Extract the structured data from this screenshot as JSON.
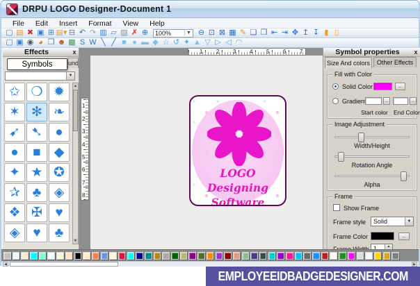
{
  "window": {
    "title": "DRPU LOGO Designer-Document 1"
  },
  "menu": {
    "items": [
      "File",
      "Edit",
      "Insert",
      "Format",
      "View",
      "Help"
    ]
  },
  "toolbar1": {
    "zoom_value": "100%",
    "icons_left": [
      {
        "name": "new-document",
        "glyph": "▢",
        "color": "#3b7fd6"
      },
      {
        "name": "open-folder",
        "glyph": "▤",
        "color": "#e09b3a"
      },
      {
        "name": "close-document",
        "glyph": "✖",
        "color": "#d02f2f"
      },
      {
        "name": "save",
        "glyph": "▣",
        "color": "#3b7fd6"
      },
      {
        "name": "save-all",
        "glyph": "⊞",
        "color": "#3b7fd6"
      },
      {
        "name": "open-recent",
        "glyph": "▤▾",
        "color": "#e09b3a"
      },
      {
        "name": "print",
        "glyph": "⊟",
        "color": "#6a7b8c"
      },
      {
        "name": "undo",
        "glyph": "↶",
        "color": "#2f6fd0"
      },
      {
        "name": "redo",
        "glyph": "↷",
        "color": "#9aa4b0"
      },
      {
        "name": "import-image",
        "glyph": "▥",
        "color": "#3b7fd6"
      },
      {
        "name": "copy",
        "glyph": "▱",
        "color": "#3b7fd6"
      },
      {
        "name": "paste",
        "glyph": "▨",
        "color": "#8a93a0"
      },
      {
        "name": "delete",
        "glyph": "✗",
        "color": "#d02f2f"
      },
      {
        "name": "zoom-in",
        "glyph": "⊕",
        "color": "#2f6fd0"
      }
    ],
    "icons_right": [
      {
        "name": "zoom-out",
        "glyph": "⊖",
        "color": "#2f6fd0"
      },
      {
        "name": "actual-size",
        "glyph": "⊡",
        "color": "#2f6fd0"
      },
      {
        "name": "fit-to-window",
        "glyph": "⊠",
        "color": "#2f6fd0"
      },
      {
        "name": "grid",
        "glyph": "▦",
        "color": "#2f6fd0"
      },
      {
        "name": "page-setup",
        "glyph": "✎",
        "color": "#caa23a"
      },
      {
        "name": "bring-to-front",
        "glyph": "❏",
        "color": "#4a5fc0"
      },
      {
        "name": "send-to-back",
        "glyph": "❐",
        "color": "#4a5fc0"
      },
      {
        "name": "align-left",
        "glyph": "⇤",
        "color": "#2f6fd0"
      },
      {
        "name": "align-right",
        "glyph": "⇥",
        "color": "#2f6fd0"
      },
      {
        "name": "align-center",
        "glyph": "✥",
        "color": "#2f6fd0"
      },
      {
        "name": "align-top",
        "glyph": "↥",
        "color": "#2f6fd0"
      },
      {
        "name": "align-bottom",
        "glyph": "↧",
        "color": "#2f6fd0"
      },
      {
        "name": "lock",
        "glyph": "▮",
        "color": "#e8a020"
      },
      {
        "name": "unlock",
        "glyph": "▯",
        "color": "#e8a020"
      }
    ]
  },
  "toolbar2": {
    "icons": [
      {
        "name": "insert-document",
        "glyph": "▢",
        "color": "#3b7fd6"
      },
      {
        "name": "insert-image",
        "glyph": "▣",
        "color": "#3b7fd6"
      },
      {
        "name": "camera",
        "glyph": "◉",
        "color": "#555a60"
      },
      {
        "name": "color-wheel",
        "glyph": "◕",
        "color": "#d0762f"
      },
      {
        "name": "library",
        "glyph": "❒",
        "color": "#3b7fd6"
      },
      {
        "name": "users",
        "glyph": "☻",
        "color": "#b0622f"
      },
      {
        "name": "picture-frame",
        "glyph": "▩",
        "color": "#3f9f5f"
      },
      {
        "name": "skew-text",
        "glyph": "S",
        "color": "#2f6fd0"
      },
      {
        "name": "word-art",
        "glyph": "W",
        "color": "#2f6fd0"
      },
      {
        "name": "line-tool",
        "glyph": "╲",
        "color": "#2f6fd0"
      },
      {
        "name": "pencil-line",
        "glyph": "╱",
        "color": "#2f6fd0"
      },
      {
        "name": "rectangle",
        "glyph": "■",
        "color": "#7fc0e8"
      },
      {
        "name": "ellipse",
        "glyph": "●",
        "color": "#7fc0e8"
      },
      {
        "name": "rounded-rectangle",
        "glyph": "▬",
        "color": "#7fc0e8"
      },
      {
        "name": "diamond",
        "glyph": "◆",
        "color": "#7fc0e8"
      },
      {
        "name": "star",
        "glyph": "☆",
        "color": "#5fa8dc"
      },
      {
        "name": "spiral",
        "glyph": "↺",
        "color": "#5fa8dc"
      },
      {
        "name": "burst",
        "glyph": "✦",
        "color": "#5fa8dc"
      },
      {
        "name": "triangle-up",
        "glyph": "▲",
        "color": "#7fc0e8"
      },
      {
        "name": "triangle-down",
        "glyph": "▽",
        "color": "#5fa8dc"
      },
      {
        "name": "triangle-right",
        "glyph": "▷",
        "color": "#5fa8dc"
      },
      {
        "name": "triangle-left",
        "glyph": "◁",
        "color": "#5fa8dc"
      },
      {
        "name": "arc",
        "glyph": "◠",
        "color": "#5fa8dc"
      }
    ]
  },
  "effects_panel": {
    "title": "Effects",
    "close": "x",
    "tooltip": "Symbols",
    "backgrounds_tab_visible": "unds",
    "selected_index": 4,
    "symbols": [
      {
        "name": "star-outline",
        "glyph": "✩"
      },
      {
        "name": "dashed-circle",
        "glyph": "❍"
      },
      {
        "name": "spiky-ball",
        "glyph": "✹"
      },
      {
        "name": "six-point-star",
        "glyph": "✶"
      },
      {
        "name": "flower",
        "glyph": "✻"
      },
      {
        "name": "leaf-swoosh",
        "glyph": "❧"
      },
      {
        "name": "curved-arrow",
        "glyph": "➹"
      },
      {
        "name": "swoosh-arrow",
        "glyph": "➷"
      },
      {
        "name": "egg",
        "glyph": "●"
      },
      {
        "name": "ellipse",
        "glyph": "●"
      },
      {
        "name": "square",
        "glyph": "■"
      },
      {
        "name": "diamond",
        "glyph": "◆"
      },
      {
        "name": "sparkle",
        "glyph": "✦"
      },
      {
        "name": "five-point-star",
        "glyph": "★"
      },
      {
        "name": "circle-star",
        "glyph": "✪"
      },
      {
        "name": "square-star",
        "glyph": "✰"
      },
      {
        "name": "club",
        "glyph": "♣"
      },
      {
        "name": "diamond-outline-star",
        "glyph": "◈"
      },
      {
        "name": "diamond-sparkle",
        "glyph": "❖"
      },
      {
        "name": "diamond-cross",
        "glyph": "✠"
      },
      {
        "name": "heart",
        "glyph": "♥"
      },
      {
        "name": "diamond-in-diamond",
        "glyph": "◈"
      },
      {
        "name": "heart-2",
        "glyph": "♥"
      },
      {
        "name": "club-2",
        "glyph": "♣"
      }
    ]
  },
  "canvas": {
    "h_ruler": [
      1,
      2,
      3,
      4,
      5,
      6,
      7
    ],
    "v_ruler": [
      1,
      2,
      3,
      4,
      5,
      6,
      7,
      8
    ],
    "logo": {
      "line1": "LOGO Designing",
      "line2": "Software",
      "flower_color": "#e816c8",
      "text_color": "#e218b8"
    }
  },
  "properties_panel": {
    "title": "Symbol properties",
    "close": "x",
    "tabs": [
      "Size And colors",
      "Other Effects"
    ],
    "fill": {
      "legend": "Fill with Color",
      "solid_label": "Solid Color",
      "gradient_label": "Gradient",
      "start_label": "Start color",
      "end_label": "End Color",
      "solid_color": "#ff00ff",
      "ellipsis": "..."
    },
    "adjust": {
      "legend": "Image Adjustment",
      "sliders": [
        {
          "label": "Width/Height",
          "value": 35
        },
        {
          "label": "Rotation Angle",
          "value": 8
        },
        {
          "label": "Alpha",
          "value": 92
        }
      ]
    },
    "frame": {
      "legend": "Frame",
      "show_label": "Show Frame",
      "style_label": "Frame style",
      "style_value": "Solid",
      "color_label": "Frame Color",
      "color_value": "#000000",
      "width_label": "Frame Width",
      "width_value": "1",
      "ellipsis": "..."
    }
  },
  "palette": {
    "colors": [
      "#c0c0c0",
      "#f0f8ff",
      "#faebd7",
      "#00ffff",
      "#7fffd4",
      "#f0ffff",
      "#f5f5dc",
      "#ffe4c4",
      "#000000",
      "#ffebcd",
      "#ff7f50",
      "#6495ed",
      "#fff8dc",
      "#dc143c",
      "#00ffff",
      "#00008b",
      "#008b8b",
      "#b8860b",
      "#a9a9a9",
      "#006400",
      "#bdb76b",
      "#8b008b",
      "#556b2f",
      "#ff8c00",
      "#9932cc",
      "#8b0000",
      "#e9967a",
      "#8fbc8f",
      "#483d8b",
      "#2f4f4f",
      "#00ced1",
      "#9400d3",
      "#ff1493",
      "#00bfff",
      "#696969",
      "#1e90ff",
      "#b22222",
      "#fffaf0",
      "#228b22",
      "#ff00ff",
      "#dcdcdc",
      "#f8f8ff",
      "#ffd700",
      "#daa520",
      "#808080"
    ]
  },
  "banner": {
    "text": "EMPLOYEEIDBADGEDESIGNER.COM",
    "bg": "#56519f"
  }
}
